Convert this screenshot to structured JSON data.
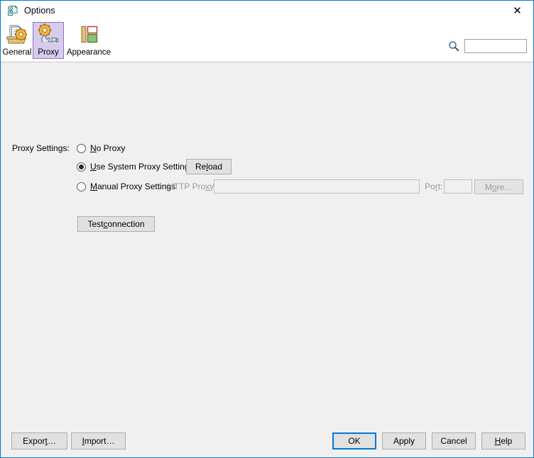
{
  "window": {
    "title": "Options",
    "icon": "options-window-icon",
    "close_label": "✕"
  },
  "toolbar": {
    "items": [
      {
        "id": "general",
        "label": "General",
        "icon": "general-settings-icon",
        "selected": false
      },
      {
        "id": "proxy",
        "label": "Proxy",
        "icon": "proxy-gear-wrench-icon",
        "selected": true
      },
      {
        "id": "appearance",
        "label": "Appearance",
        "icon": "appearance-layout-icon",
        "selected": false
      }
    ],
    "search": {
      "icon": "search-icon",
      "value": "",
      "placeholder": ""
    }
  },
  "main": {
    "settings_label": "Proxy Settings:",
    "radios": [
      {
        "id": "no-proxy",
        "label_pre": "",
        "label_mnemonic": "N",
        "label_post": "o Proxy",
        "checked": false
      },
      {
        "id": "use-system-proxy-settings",
        "label_pre": "",
        "label_mnemonic": "U",
        "label_post": "se System Proxy Settings",
        "checked": true
      },
      {
        "id": "manual-proxy-settings",
        "label_pre": "",
        "label_mnemonic": "M",
        "label_post": "anual Proxy Settings",
        "checked": false
      }
    ],
    "reload_button": {
      "pre": "Re",
      "mnemonic": "l",
      "post": "oad",
      "enabled": true
    },
    "http_proxy_label": {
      "pre": "HTTP Pro",
      "mnemonic": "x",
      "post": "y:",
      "enabled": false
    },
    "http_proxy_input": {
      "value": "",
      "placeholder": "",
      "enabled": false
    },
    "port_label": {
      "pre": "Po",
      "mnemonic": "r",
      "post": "t:",
      "enabled": false
    },
    "port_input": {
      "value": "",
      "placeholder": "",
      "enabled": false
    },
    "more_button": {
      "pre": "M",
      "mnemonic": "o",
      "post": "re…",
      "enabled": false
    },
    "test_connection_button": {
      "pre": "Test ",
      "mnemonic": "c",
      "post": "onnection",
      "enabled": true
    }
  },
  "footer": {
    "export_button": {
      "pre": "Expor",
      "mnemonic": "t",
      "post": "…"
    },
    "import_button": {
      "pre": "",
      "mnemonic": "I",
      "post": "mport…"
    },
    "ok_button": {
      "pre": "OK",
      "mnemonic": "",
      "post": "",
      "default": true
    },
    "apply_button": {
      "pre": "Apply",
      "mnemonic": "",
      "post": ""
    },
    "cancel_button": {
      "pre": "Cancel",
      "mnemonic": "",
      "post": ""
    },
    "help_button": {
      "pre": "",
      "mnemonic": "H",
      "post": "elp"
    }
  },
  "colors": {
    "accent": "#0078d7",
    "window_bg": "#f0f0f0",
    "header_bg": "#ffffff",
    "selection_bg": "#d6ccec",
    "selection_border": "#8d72c4",
    "disabled_text": "#9a9a9a",
    "button_face": "#e1e1e1",
    "title_icon": "#1b7b84"
  }
}
